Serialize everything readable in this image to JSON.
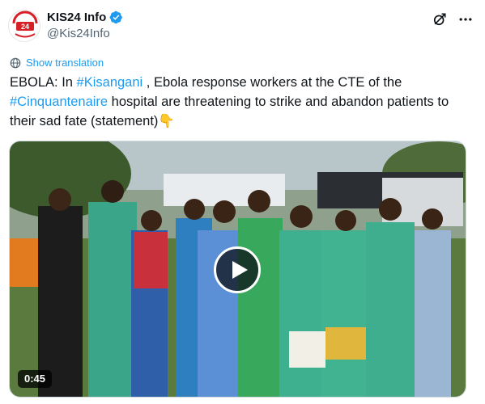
{
  "author": {
    "display_name": "KIS24 Info",
    "handle": "@Kis24Info",
    "verified": true,
    "avatar_icon": "kis24-logo-icon",
    "avatar_text": "KIS24 Info",
    "logo_letters": "24"
  },
  "actions": {
    "grok_icon": "grok-icon",
    "more_icon": "more-icon"
  },
  "translation": {
    "label": "Show translation",
    "icon": "globe-icon"
  },
  "tweet": {
    "prefix": "EBOLA: In ",
    "hashtag1": "#Kisangani",
    "mid1": " , Ebola response workers at the CTE of the ",
    "hashtag2": "#Cinquantenaire",
    "mid2": " hospital are threatening to strike and abandon patients to their sad fate (statement)",
    "emoji": "👇"
  },
  "video": {
    "duration": "0:45",
    "play_icon": "play-icon"
  },
  "colors": {
    "link": "#1d9bf0",
    "text": "#0f1419",
    "secondary": "#536471",
    "verified": "#1d9bf0"
  }
}
